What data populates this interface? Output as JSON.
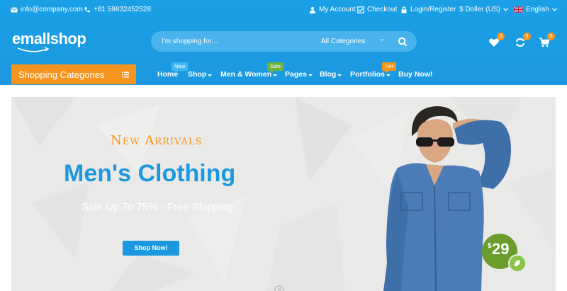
{
  "topbar": {
    "email": "info@company.com",
    "phone": "+81 59832452528",
    "my_account": "My Account",
    "checkout": "Checkout",
    "login": "Login/Register",
    "currency": "$ Doller (US)",
    "language": "English"
  },
  "logo": {
    "text": "emallshop"
  },
  "search": {
    "placeholder": "I'm shopping for...",
    "category": "All Categories"
  },
  "header_icons": {
    "wishlist_count": "0",
    "compare_count": "0",
    "cart_count": "0"
  },
  "categories_button": {
    "label": "Shopping Categories"
  },
  "nav": {
    "items": [
      {
        "label": "Home",
        "badge": "New"
      },
      {
        "label": "Shop"
      },
      {
        "label": "Men & Women",
        "badge": "Sale"
      },
      {
        "label": "Pages"
      },
      {
        "label": "Blog"
      },
      {
        "label": "Portfolios",
        "badge": "Hot"
      },
      {
        "label": "Buy Now!"
      }
    ]
  },
  "hero": {
    "subtitle": "New Arrivals",
    "title": "Men's Clothing",
    "promo": "Sale Up To 75% - Free Shipping",
    "button": "Shop Now!",
    "price_currency": "$",
    "price": "29"
  },
  "colors": {
    "brand_blue": "#1b98e0",
    "accent_orange": "#f7941d",
    "tag_new": "#3fb7f2",
    "tag_sale": "#6db33f",
    "tag_hot": "#f7941d",
    "price_green": "#6a9d2b"
  }
}
